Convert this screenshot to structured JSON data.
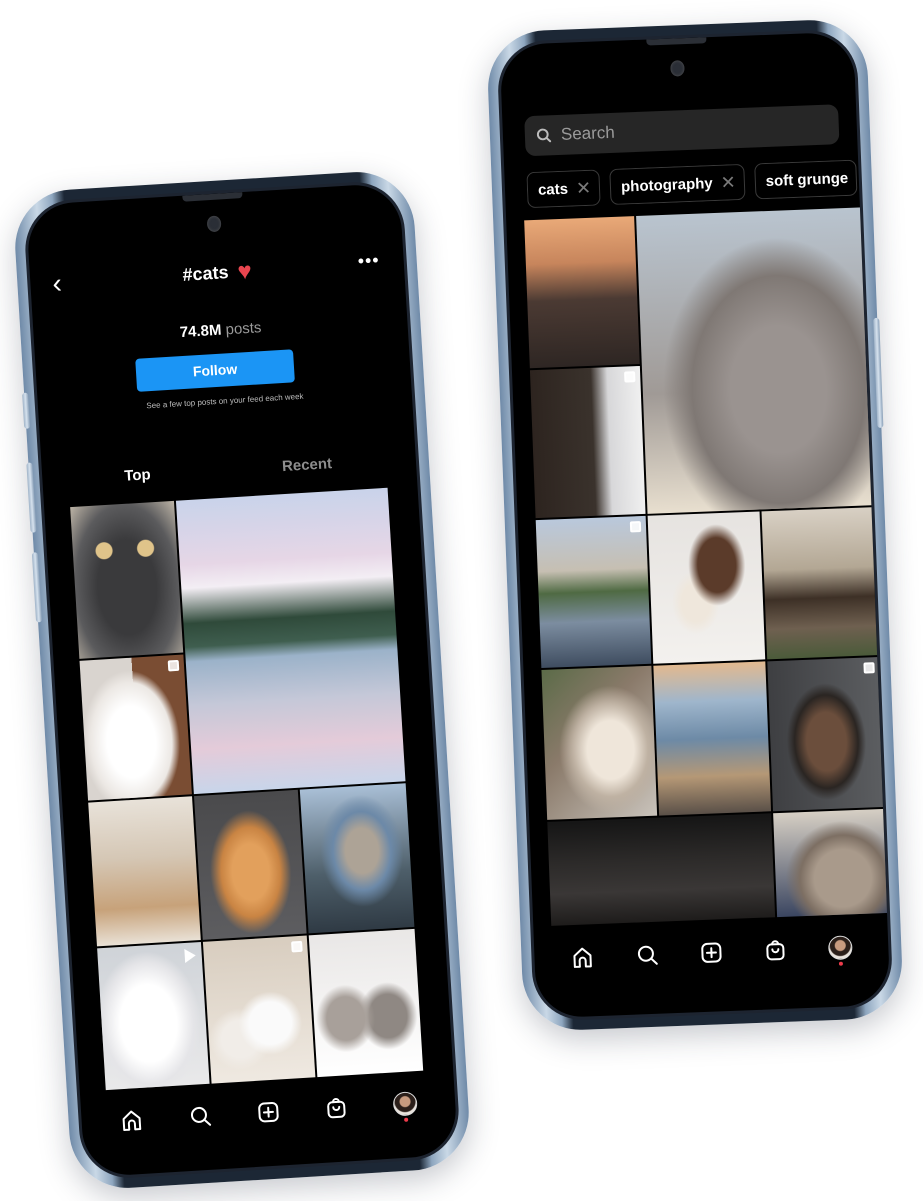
{
  "hashtag_screen": {
    "header": {
      "back_icon": "chevron-left-icon",
      "title": "#cats",
      "title_emoji": "♥",
      "more_icon": "ellipsis-icon"
    },
    "stats": {
      "post_count": "74.8M",
      "post_unit": "posts"
    },
    "follow_button": {
      "label": "Follow",
      "color": "#1b95f5"
    },
    "follow_hint": "See a few top posts on your feed each week",
    "tabs": [
      {
        "label": "Top",
        "active": true
      },
      {
        "label": "Recent",
        "active": false
      }
    ],
    "grid": [
      {
        "subject": "wide-eyed black cat",
        "badge": ""
      },
      {
        "subject": "cat leaping over mountain lake",
        "badge": ""
      },
      {
        "subject": "white fluffy kitten",
        "badge": "multiple-posts-icon"
      },
      {
        "subject": "cats on cat tree",
        "badge": ""
      },
      {
        "subject": "orange kitten sitting",
        "badge": ""
      },
      {
        "subject": "cat with blue scarf",
        "badge": ""
      },
      {
        "subject": "white cat wearing tie",
        "badge": "play-icon"
      },
      {
        "subject": "group of white kittens",
        "badge": "multiple-posts-icon"
      },
      {
        "subject": "two kittens with bow and tie",
        "badge": ""
      }
    ]
  },
  "explore_screen": {
    "search": {
      "placeholder": "Search",
      "value": ""
    },
    "chips": [
      {
        "label": "cats",
        "removable": true
      },
      {
        "label": "photography",
        "removable": true
      },
      {
        "label": "soft grunge",
        "removable": false
      }
    ],
    "grid": [
      {
        "subject": "Paris street with Eiffel Tower",
        "badge": ""
      },
      {
        "subject": "fluffy grey kitten on book",
        "badge": ""
      },
      {
        "subject": "fishnet tights and boots",
        "badge": "multiple-posts-icon"
      },
      {
        "subject": "misty lake",
        "badge": "multiple-posts-icon"
      },
      {
        "subject": "two cats on wall shelf",
        "badge": ""
      },
      {
        "subject": "Parisian cafe",
        "badge": ""
      },
      {
        "subject": "cat by window",
        "badge": ""
      },
      {
        "subject": "two cats at harbor",
        "badge": ""
      },
      {
        "subject": "woman in long coat",
        "badge": "multiple-posts-icon"
      },
      {
        "subject": "black heeled shoes",
        "badge": ""
      },
      {
        "subject": "tabby kitten resting",
        "badge": ""
      }
    ]
  },
  "bottom_nav": {
    "items": [
      {
        "name": "home",
        "icon": "home-icon"
      },
      {
        "name": "search",
        "icon": "search-icon"
      },
      {
        "name": "create",
        "icon": "plus-square-icon"
      },
      {
        "name": "shop",
        "icon": "shopping-bag-icon"
      },
      {
        "name": "profile",
        "icon": "avatar",
        "notification": true
      }
    ],
    "notification_color": "#ed3b4b"
  }
}
